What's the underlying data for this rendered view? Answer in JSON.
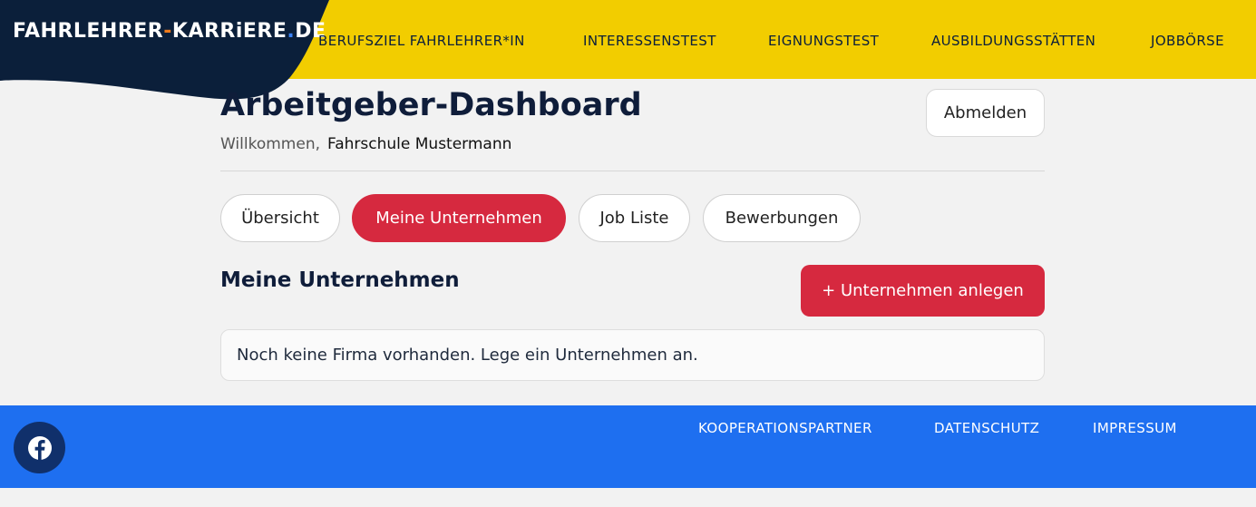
{
  "logo": {
    "part1": "FAHRLEHRER",
    "dash": "-",
    "part2": "KARRiERE",
    "dot": ".",
    "part3": "DE"
  },
  "nav": {
    "items": [
      {
        "label": "BERUFSZIEL FAHRLEHRER*IN"
      },
      {
        "label": "INTERESSENSTEST"
      },
      {
        "label": "EIGNUNGSTEST"
      },
      {
        "label": "AUSBILDUNGSSTÄTTEN"
      },
      {
        "label": "JOBBÖRSE"
      }
    ]
  },
  "dashboard": {
    "title": "Arbeitgeber-Dashboard",
    "welcome_label": "Willkommen,",
    "company_name": "Fahrschule Mustermann",
    "logout_label": "Abmelden"
  },
  "tabs": [
    {
      "label": "Übersicht",
      "active": false
    },
    {
      "label": "Meine Unternehmen",
      "active": true
    },
    {
      "label": "Job Liste",
      "active": false
    },
    {
      "label": "Bewerbungen",
      "active": false
    }
  ],
  "companies": {
    "section_title": "Meine Unternehmen",
    "add_button_label": "+ Unternehmen anlegen",
    "empty_message": "Noch keine Firma vorhanden. Lege ein Unternehmen an."
  },
  "footer": {
    "links": [
      {
        "label": "KOOPERATIONSPARTNER"
      },
      {
        "label": "DATENSCHUTZ"
      },
      {
        "label": "IMPRESSUM"
      }
    ],
    "social_icon": "facebook-icon"
  },
  "colors": {
    "header_bg": "#f2cd00",
    "logo_bg": "#0b1f3a",
    "accent_red": "#d6293f",
    "footer_bg": "#1e6ff0",
    "page_bg": "#f2f2f2"
  }
}
